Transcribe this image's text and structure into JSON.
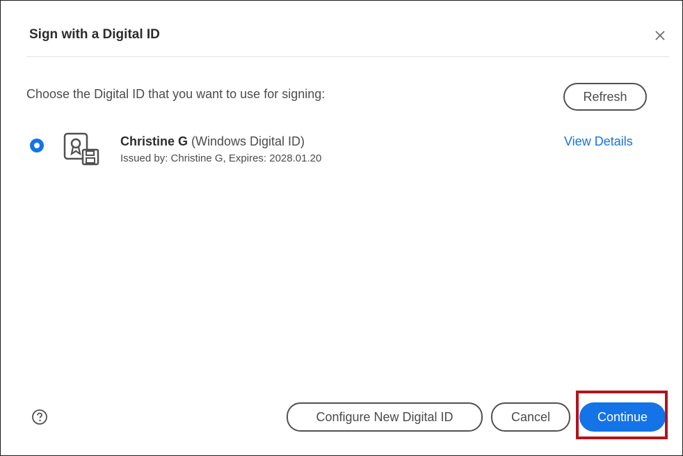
{
  "dialog": {
    "title": "Sign with a Digital ID",
    "close_icon": "close-icon"
  },
  "prompt": "Choose the Digital ID that you want to use for signing:",
  "refresh_label": "Refresh",
  "digital_id": {
    "selected": true,
    "name": "Christine G",
    "type": " (Windows Digital ID)",
    "issued_by": "Issued by: Christine G, Expires: 2028.01.20",
    "view_details_label": "View Details",
    "icon": "certificate-icon"
  },
  "footer": {
    "help_icon": "help-icon",
    "configure_label": "Configure New Digital ID",
    "cancel_label": "Cancel",
    "continue_label": "Continue"
  },
  "colors": {
    "accent": "#1473e6",
    "highlight": "#b0141c"
  }
}
